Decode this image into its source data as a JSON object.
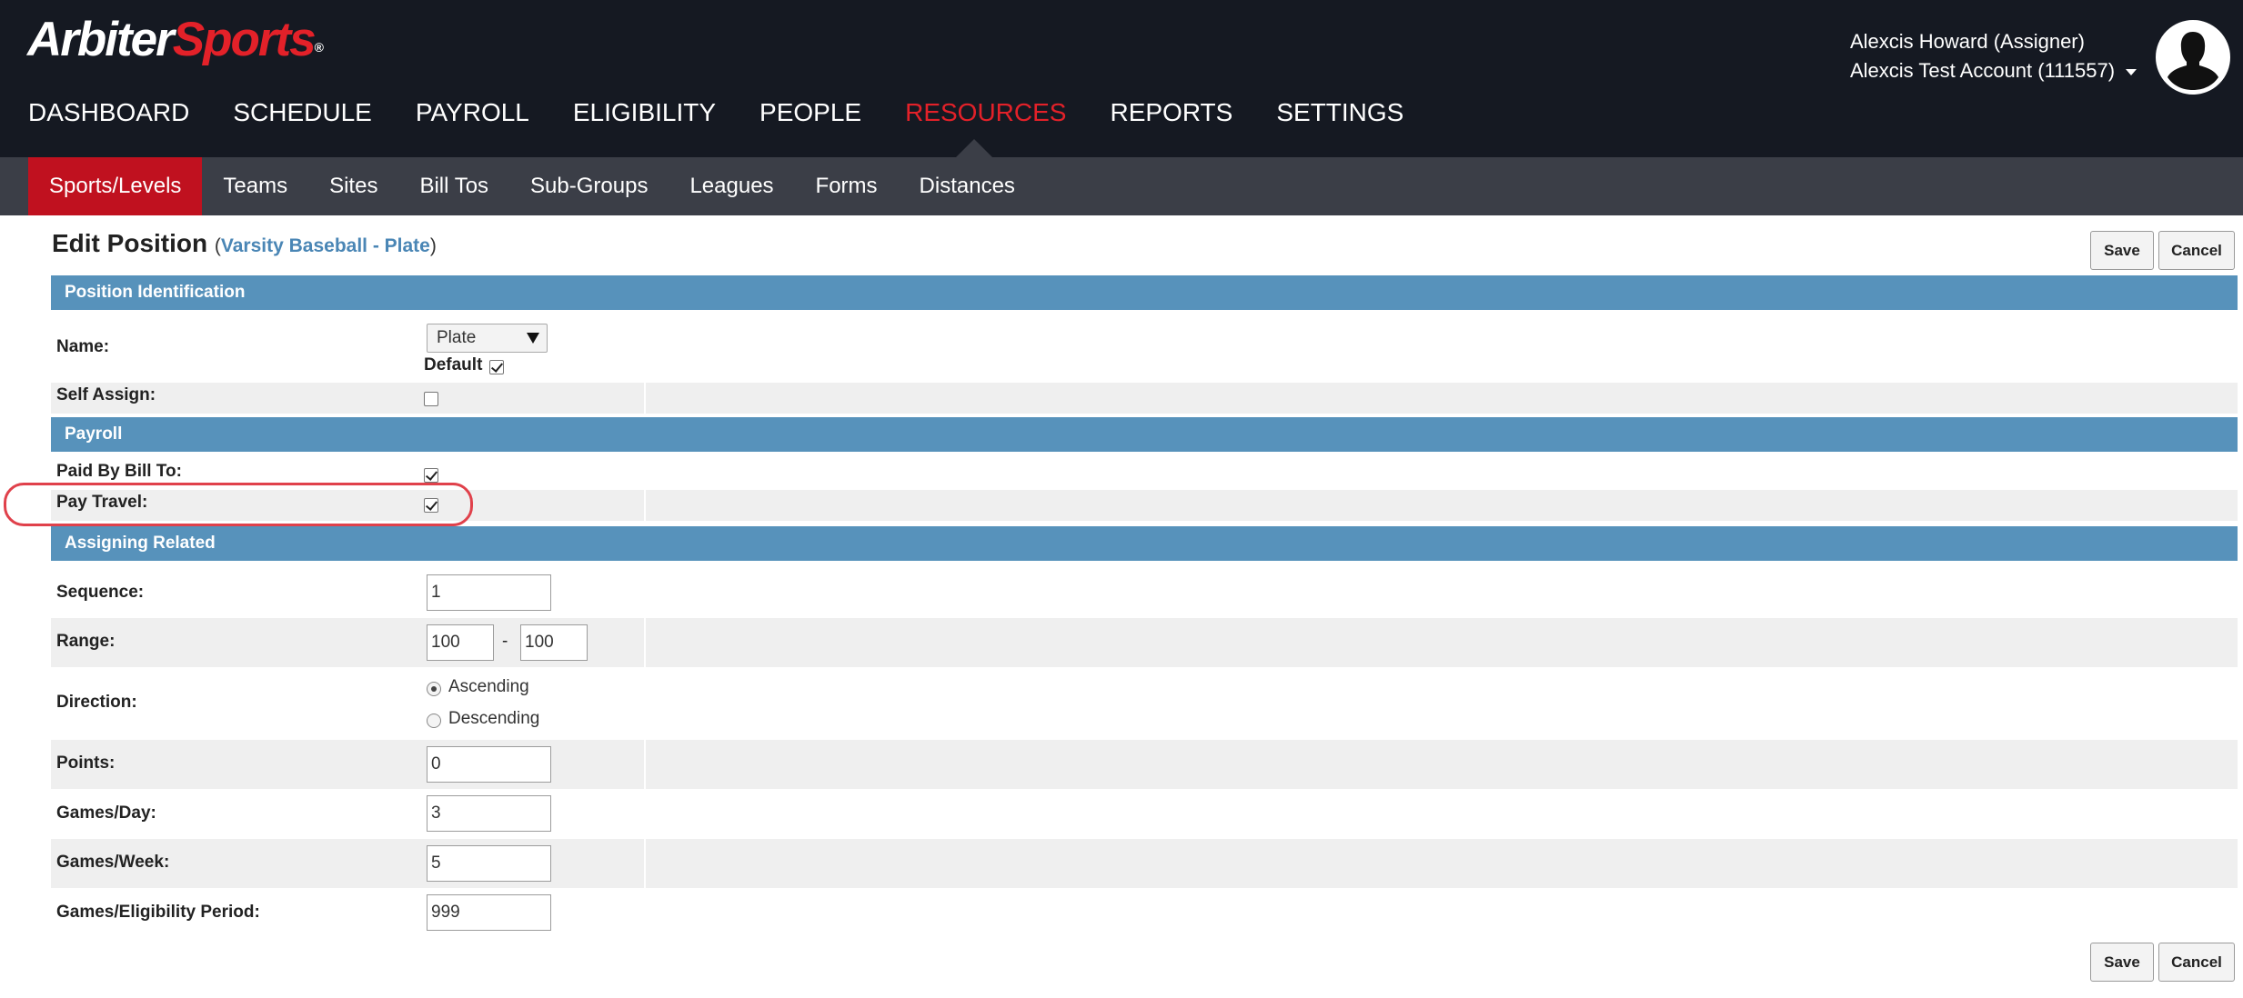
{
  "header": {
    "logo_part1": "Arbiter",
    "logo_part2": "Sports",
    "logo_tm": "®",
    "user_name": "Alexcis Howard (Assigner)",
    "account": "Alexcis Test Account (111557)"
  },
  "main_nav": [
    {
      "label": "DASHBOARD"
    },
    {
      "label": "SCHEDULE"
    },
    {
      "label": "PAYROLL"
    },
    {
      "label": "ELIGIBILITY"
    },
    {
      "label": "PEOPLE"
    },
    {
      "label": "RESOURCES"
    },
    {
      "label": "REPORTS"
    },
    {
      "label": "SETTINGS"
    }
  ],
  "sub_nav": [
    {
      "label": "Sports/Levels"
    },
    {
      "label": "Teams"
    },
    {
      "label": "Sites"
    },
    {
      "label": "Bill Tos"
    },
    {
      "label": "Sub-Groups"
    },
    {
      "label": "Leagues"
    },
    {
      "label": "Forms"
    },
    {
      "label": "Distances"
    }
  ],
  "page": {
    "title": "Edit Position",
    "open_paren": "(",
    "breadcrumb": "Varsity Baseball - Plate",
    "close_paren": ")",
    "save_label": "Save",
    "cancel_label": "Cancel"
  },
  "sections": {
    "identification": "Position Identification",
    "payroll": "Payroll",
    "assigning": "Assigning Related"
  },
  "fields": {
    "name_label": "Name:",
    "name_value": "Plate",
    "default_label": "Default",
    "self_assign_label": "Self Assign:",
    "paid_by_bill_to_label": "Paid By Bill To:",
    "pay_travel_label": "Pay Travel:",
    "sequence_label": "Sequence:",
    "sequence_value": "1",
    "range_label": "Range:",
    "range_from": "100",
    "range_sep": "-",
    "range_to": "100",
    "direction_label": "Direction:",
    "direction_asc": "Ascending",
    "direction_desc": "Descending",
    "points_label": "Points:",
    "points_value": "0",
    "games_day_label": "Games/Day:",
    "games_day_value": "3",
    "games_week_label": "Games/Week:",
    "games_week_value": "5",
    "games_period_label": "Games/Eligibility Period:",
    "games_period_value": "999"
  },
  "colors": {
    "header_bg": "#151922",
    "subnav_bg": "#3b3e47",
    "active_red": "#e32129",
    "section_blue": "#5792bb",
    "highlight": "#e0414b"
  }
}
